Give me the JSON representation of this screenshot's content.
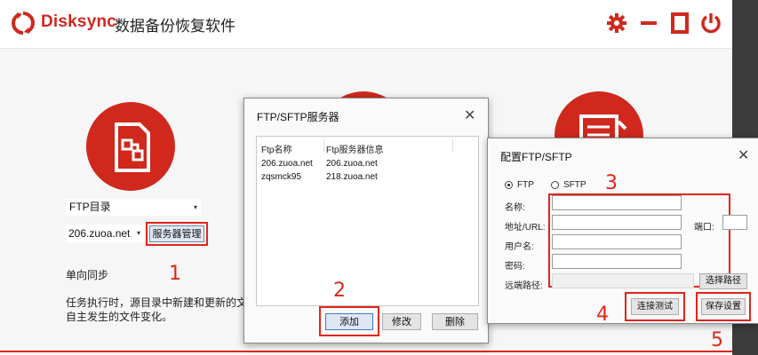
{
  "app": {
    "brand": "Disksync",
    "subtitle": "数据备份恢复软件",
    "accent": "#d0281d"
  },
  "titlebar_icons": [
    "gear-icon",
    "minimize-icon",
    "maximize-icon",
    "power-icon"
  ],
  "left_panel": {
    "source_select": "FTP目录",
    "server_select": "206.zuoa.net",
    "server_manage_button": "服务器管理",
    "mode_title": "单向同步",
    "description_line1": "任务执行时，源目录中新建和更新的文",
    "description_line2": "自主发生的文件变化。"
  },
  "ftp_dialog": {
    "title": "FTP/SFTP服务器",
    "columns": [
      "Ftp名称",
      "Ftp服务器信息"
    ],
    "rows": [
      [
        "206.zuoa.net",
        "206.zuoa.net"
      ],
      [
        "zqsmck95",
        "218.zuoa.net"
      ]
    ],
    "add_button": "添加",
    "edit_button": "修改",
    "delete_button": "删除"
  },
  "config_dialog": {
    "title": "配置FTP/SFTP",
    "protocol_ftp": "FTP",
    "protocol_sftp": "SFTP",
    "selected_protocol": "FTP",
    "name_label": "名称:",
    "address_label": "地址/URL:",
    "port_label": "端口:",
    "username_label": "用户名:",
    "password_label": "密码:",
    "remote_path_label": "远端路径:",
    "choose_path_button": "选择路径",
    "test_button": "连接测试",
    "save_button": "保存设置"
  },
  "annotations": [
    "1",
    "2",
    "3",
    "4",
    "5"
  ]
}
